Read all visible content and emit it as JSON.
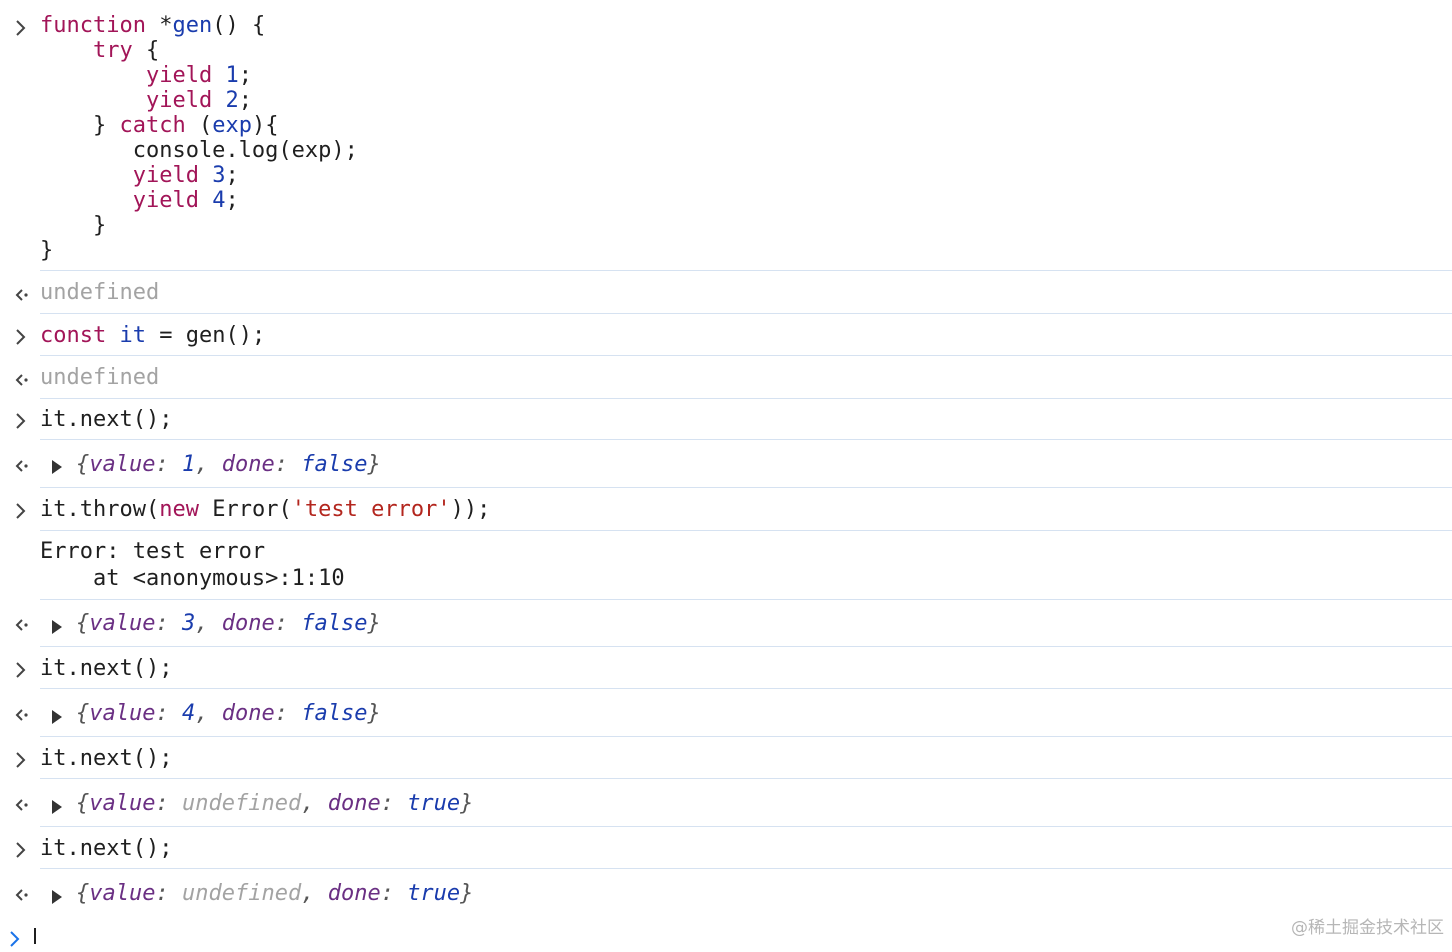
{
  "code_block": {
    "lines": [
      [
        {
          "t": "function",
          "c": "kw"
        },
        {
          "t": " *",
          "c": "plain"
        },
        {
          "t": "gen",
          "c": "fn"
        },
        {
          "t": "() {",
          "c": "plain"
        }
      ],
      [
        {
          "t": "    ",
          "c": "plain"
        },
        {
          "t": "try",
          "c": "kw"
        },
        {
          "t": " {",
          "c": "plain"
        }
      ],
      [
        {
          "t": "        ",
          "c": "plain"
        },
        {
          "t": "yield",
          "c": "kw"
        },
        {
          "t": " ",
          "c": "plain"
        },
        {
          "t": "1",
          "c": "num"
        },
        {
          "t": ";",
          "c": "plain"
        }
      ],
      [
        {
          "t": "        ",
          "c": "plain"
        },
        {
          "t": "yield",
          "c": "kw"
        },
        {
          "t": " ",
          "c": "plain"
        },
        {
          "t": "2",
          "c": "num"
        },
        {
          "t": ";",
          "c": "plain"
        }
      ],
      [
        {
          "t": "    } ",
          "c": "plain"
        },
        {
          "t": "catch",
          "c": "kw"
        },
        {
          "t": " (",
          "c": "plain"
        },
        {
          "t": "exp",
          "c": "fn"
        },
        {
          "t": "){",
          "c": "plain"
        }
      ],
      [
        {
          "t": "       console.log(exp);",
          "c": "plain"
        }
      ],
      [
        {
          "t": "       ",
          "c": "plain"
        },
        {
          "t": "yield",
          "c": "kw"
        },
        {
          "t": " ",
          "c": "plain"
        },
        {
          "t": "3",
          "c": "num"
        },
        {
          "t": ";",
          "c": "plain"
        }
      ],
      [
        {
          "t": "       ",
          "c": "plain"
        },
        {
          "t": "yield",
          "c": "kw"
        },
        {
          "t": " ",
          "c": "plain"
        },
        {
          "t": "4",
          "c": "num"
        },
        {
          "t": ";",
          "c": "plain"
        }
      ],
      [
        {
          "t": "    }",
          "c": "plain"
        }
      ],
      [
        {
          "t": "}",
          "c": "plain"
        }
      ]
    ]
  },
  "entries": {
    "result_undefined_1": "undefined",
    "input_const": [
      {
        "t": "const",
        "c": "kw"
      },
      {
        "t": " ",
        "c": "plain"
      },
      {
        "t": "it",
        "c": "fn"
      },
      {
        "t": " = gen();",
        "c": "plain"
      }
    ],
    "result_undefined_2": "undefined",
    "input_next_1": "it.next();",
    "result_obj_1": {
      "value": "1",
      "done": "false",
      "value_is_undefined": false
    },
    "input_throw": [
      {
        "t": "it.throw(",
        "c": "plain"
      },
      {
        "t": "new",
        "c": "kw"
      },
      {
        "t": " Error(",
        "c": "plain"
      },
      {
        "t": "'test error'",
        "c": "str"
      },
      {
        "t": "));",
        "c": "plain"
      }
    ],
    "log_error_line1": "Error: test error",
    "log_error_line2": "    at <anonymous>:1:10",
    "result_obj_2": {
      "value": "3",
      "done": "false",
      "value_is_undefined": false
    },
    "input_next_2": "it.next();",
    "result_obj_3": {
      "value": "4",
      "done": "false",
      "value_is_undefined": false
    },
    "input_next_3": "it.next();",
    "result_obj_4": {
      "value": "undefined",
      "done": "true",
      "value_is_undefined": true
    },
    "input_next_4": "it.next();",
    "result_obj_5": {
      "value": "undefined",
      "done": "true",
      "value_is_undefined": true
    }
  },
  "labels": {
    "key_value": "value",
    "key_done": "done"
  },
  "watermark": "@稀土掘金技术社区",
  "colors": {
    "keyword": "#a21558",
    "number": "#1a3cad",
    "string": "#b3261e",
    "muted": "#a3a3a3",
    "object_key": "#6a2f83",
    "separator": "#d6e2f1",
    "prompt_blue": "#1a73e8"
  },
  "icons": {
    "input_prompt": "chevron-right-icon",
    "result_prompt": "return-arrow-icon",
    "expand": "triangle-right-icon"
  }
}
